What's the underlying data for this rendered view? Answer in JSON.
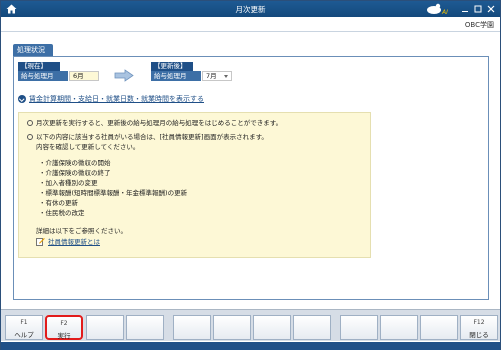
{
  "window": {
    "title": "月次更新",
    "company": "OBC学園"
  },
  "tab": {
    "label": "処理状況"
  },
  "current": {
    "header": "【現在】",
    "label": "給与処理月",
    "value": "6月"
  },
  "updated": {
    "header": "【更新後】",
    "label": "給与処理月",
    "value": "7月"
  },
  "toggle": {
    "label": "賃金計算期間・支給日・就業日数・就業時間を表示する"
  },
  "info": {
    "line1": "月次更新を実行すると、更新後の給与処理月の給与処理をはじめることができます。",
    "line2": "以下の内容に該当する社員がいる場合は、[社員情報更新]画面が表示されます。",
    "line3": "内容を確認して更新してください。",
    "items": [
      "・介護保険の徴収の開始",
      "・介護保険の徴収の終了",
      "・加入者種別の変更",
      "・標準報酬(短時間標準報酬・年金標準報酬)の更新",
      "・有休の更新",
      "・住民税の改定"
    ],
    "note": "詳細は以下をご参照ください。",
    "link": "社員情報更新とは"
  },
  "fkeys": {
    "f1": {
      "num": "F1",
      "name": "ヘルプ"
    },
    "f2": {
      "num": "F2",
      "name": "実行"
    },
    "f12": {
      "num": "F12",
      "name": "閉じる"
    }
  },
  "colors": {
    "titlebar": "#1e5a93",
    "accent": "#1f4f87",
    "highlight": "#e21b1b",
    "infobox": "#fdf8d6"
  },
  "icons": {
    "home": "home-icon",
    "logo": "obc-logo-icon",
    "arrow": "right-arrow-icon",
    "link": "edit-doc-icon"
  }
}
